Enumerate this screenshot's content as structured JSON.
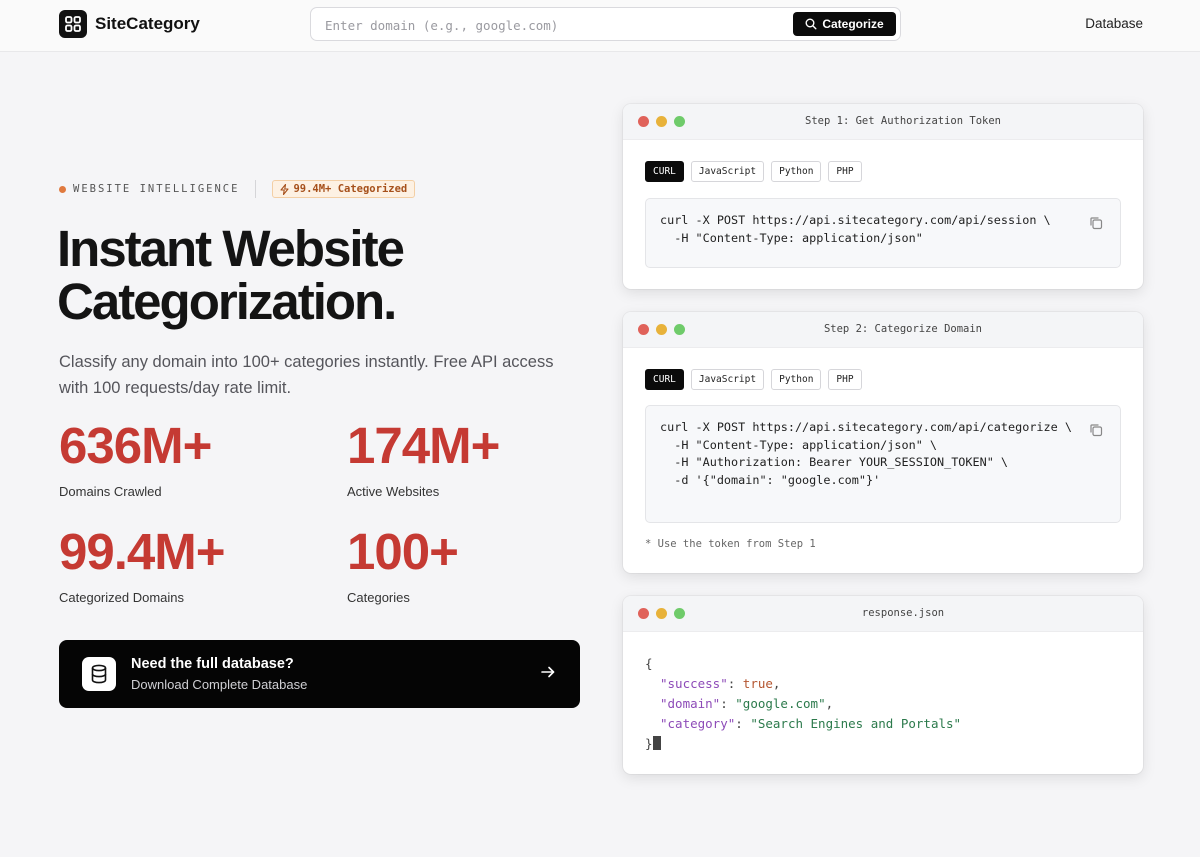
{
  "header": {
    "brand": "SiteCategory",
    "search_placeholder": "Enter domain (e.g., google.com)",
    "search_button": "Categorize",
    "nav_database": "Database"
  },
  "hero": {
    "eyebrow": "WEBSITE INTELLIGENCE",
    "badge": "99.4M+ Categorized",
    "title_line1": "Instant Website",
    "title_line2": "Categorization.",
    "subtitle": "Classify any domain into 100+ categories instantly. Free API access with 100 requests/day rate limit."
  },
  "stats": [
    {
      "value": "636M+",
      "label": "Domains Crawled"
    },
    {
      "value": "174M+",
      "label": "Active Websites"
    },
    {
      "value": "99.4M+",
      "label": "Categorized Domains"
    },
    {
      "value": "100+",
      "label": "Categories"
    }
  ],
  "cta": {
    "title": "Need the full database?",
    "subtitle": "Download Complete Database"
  },
  "windows": {
    "step1": {
      "title": "Step 1: Get Authorization Token",
      "tabs": [
        "CURL",
        "JavaScript",
        "Python",
        "PHP"
      ],
      "code": "curl -X POST https://api.sitecategory.com/api/session \\\n  -H \"Content-Type: application/json\""
    },
    "step2": {
      "title": "Step 2: Categorize Domain",
      "tabs": [
        "CURL",
        "JavaScript",
        "Python",
        "PHP"
      ],
      "code": "curl -X POST https://api.sitecategory.com/api/categorize \\\n  -H \"Content-Type: application/json\" \\\n  -H \"Authorization: Bearer YOUR_SESSION_TOKEN\" \\\n  -d '{\"domain\": \"google.com\"}'",
      "note": "* Use the token from Step 1"
    },
    "response": {
      "title": "response.json",
      "open_brace": "{",
      "close_brace": "}",
      "lines": [
        {
          "key": "\"success\"",
          "value": "true",
          "comma": ","
        },
        {
          "key": "\"domain\"",
          "value": "\"google.com\"",
          "comma": ","
        },
        {
          "key": "\"category\"",
          "value": "\"Search Engines and Portals\"",
          "comma": ""
        }
      ]
    }
  },
  "colors": {
    "accent_red": "#c53a33",
    "badge_orange": "#a6501b",
    "dark": "#0b0b0b"
  },
  "icons": {
    "logo": "grid-logo-icon",
    "search": "search-icon",
    "badge": "lightning-icon",
    "cta": "database-icon",
    "cta_arrow": "arrow-right-icon",
    "copy": "copy-icon"
  }
}
